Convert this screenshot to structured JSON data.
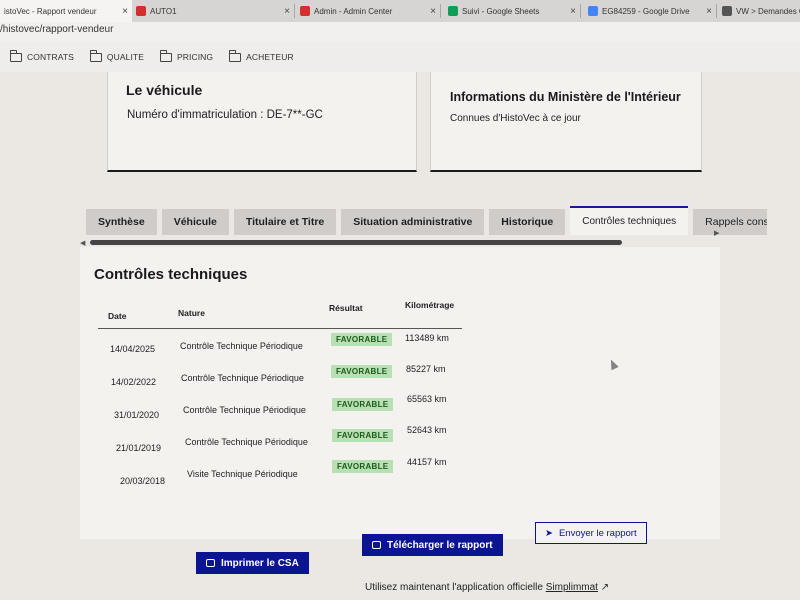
{
  "browser": {
    "tabs": [
      {
        "title": "istoVec - Rapport vendeur",
        "color": "#9e9e9e"
      },
      {
        "title": "AUTO1",
        "color": "#d32f2f"
      },
      {
        "title": "Admin - Admin Center",
        "color": "#d32f2f"
      },
      {
        "title": "Suivi - Google Sheets",
        "color": "#0f9d58"
      },
      {
        "title": "EG84259 - Google Drive",
        "color": "#4285f4"
      },
      {
        "title": "VW > Demandes Cons",
        "color": "#555555"
      }
    ],
    "url": "/histovec/rapport-vendeur",
    "bookmarks": [
      "CONTRATS",
      "QUALITE",
      "PRICING",
      "ACHETEUR"
    ]
  },
  "vehicle_card": {
    "title": "Le véhicule",
    "plate_label": "Numéro d'immatriculation : DE-7**-GC"
  },
  "ministry_card": {
    "title": "Informations du Ministère de l'Intérieur",
    "text": "Connues d'HistoVec à ce jour"
  },
  "tabs": [
    "Synthèse",
    "Véhicule",
    "Titulaire et Titre",
    "Situation administrative",
    "Historique",
    "Contrôles techniques",
    "Rappels constru"
  ],
  "active_tab": "Contrôles techniques",
  "ct": {
    "title": "Contrôles techniques",
    "headers": {
      "date": "Date",
      "nature": "Nature",
      "result": "Résultat",
      "km": "Kilométrage"
    },
    "rows": [
      {
        "date": "14/04/2025",
        "nature": "Contrôle Technique Périodique",
        "result": "FAVORABLE",
        "km": "113489 km"
      },
      {
        "date": "14/02/2022",
        "nature": "Contrôle Technique Périodique",
        "result": "FAVORABLE",
        "km": "85227 km"
      },
      {
        "date": "31/01/2020",
        "nature": "Contrôle Technique Périodique",
        "result": "FAVORABLE",
        "km": "65563 km"
      },
      {
        "date": "21/01/2019",
        "nature": "Contrôle Technique Périodique",
        "result": "FAVORABLE",
        "km": "52643 km"
      },
      {
        "date": "20/03/2018",
        "nature": "Visite Technique Périodique",
        "result": "FAVORABLE",
        "km": "44157 km"
      }
    ]
  },
  "actions": {
    "send": "Envoyer le rapport",
    "download": "Télécharger le rapport",
    "print": "Imprimer le CSA"
  },
  "footer": {
    "text": "Utilisez maintenant l'application officielle ",
    "link": "Simplimmat"
  },
  "colors": {
    "accent": "#0b1591",
    "badge_bg": "#b9e0b4",
    "badge_text": "#1c5a1a"
  }
}
